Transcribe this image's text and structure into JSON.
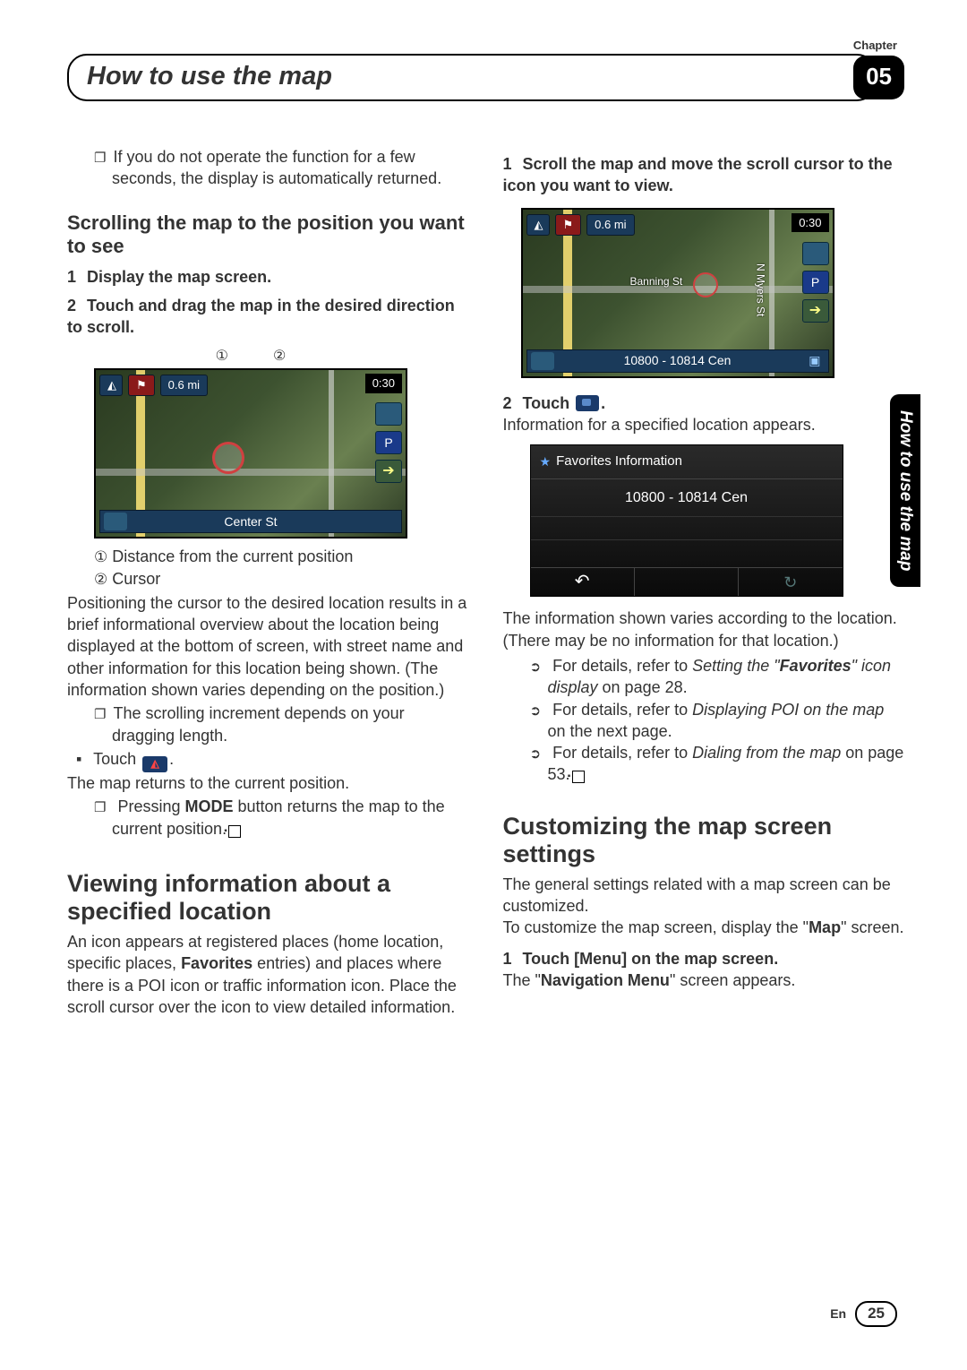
{
  "header": {
    "chapter_label": "Chapter",
    "title": "How to use the map",
    "chapter_num": "05"
  },
  "side_tab": "How to use the map",
  "footer": {
    "lang": "En",
    "page": "25"
  },
  "left": {
    "note1": "If you do not operate the function for a few seconds, the display is automatically returned.",
    "h_scroll": "Scrolling the map to the position you want to see",
    "step1": "Display the map screen.",
    "step2": "Touch and drag the map in the desired direction to scroll.",
    "fig1_label1": "①",
    "fig1_label2": "②",
    "map1": {
      "dist": "0.6 mi",
      "time": "0:30",
      "bottom": "Center St"
    },
    "leg1": "Distance from the current position",
    "leg2": "Cursor",
    "para_cursor": "Positioning the cursor to the desired location results in a brief informational overview about the location being displayed at the bottom of screen, with street name and other information for this location being shown. (The information shown varies depending on the position.)",
    "note_scroll": "The scrolling increment depends on your dragging length.",
    "touch_a_pre": "Touch ",
    "touch_a_post": ".",
    "return_text": "The map returns to the current position.",
    "note_mode_pre": "Pressing ",
    "note_mode_bold": "MODE",
    "note_mode_post": " button returns the map to the current position.",
    "h_viewing": "Viewing information about a specified location",
    "para_viewing_pre": "An icon appears at registered places (home location, specific places, ",
    "para_viewing_bold": "Favorites",
    "para_viewing_post": " entries) and places where there is a POI icon or traffic information icon. Place the scroll cursor over the icon to view detailed information."
  },
  "right": {
    "step1": "Scroll the map and move the scroll cursor to the icon you want to view.",
    "map2": {
      "dist": "0.6 mi",
      "time": "0:30",
      "bottom": "10800 - 10814 Cen",
      "street1": "Banning St",
      "street2": "N Myers St"
    },
    "step2_pre": "Touch ",
    "step2_post": ".",
    "info_appears": "Information for a specified location appears.",
    "fav": {
      "title": "Favorites Information",
      "addr": "10800 - 10814 Cen"
    },
    "para_info": "The information shown varies according to the location. (There may be no information for that location.)",
    "ref1_pre": "For details, refer to ",
    "ref1_it1": "Setting the \"",
    "ref1_bold": "Favorites",
    "ref1_it2": "\" icon display",
    "ref1_post": " on page 28.",
    "ref2_pre": "For details, refer to ",
    "ref2_it": "Displaying POI on the map",
    "ref2_post": " on the next page.",
    "ref3_pre": "For details, refer to ",
    "ref3_it": "Dialing from the map",
    "ref3_post": " on page 53.",
    "h_custom": "Customizing the map screen settings",
    "para_custom1": "The general settings related with a map screen can be customized.",
    "para_custom2_pre": "To customize the map screen, display the \"",
    "para_custom2_bold": "Map",
    "para_custom2_post": "\" screen.",
    "step_custom": "Touch [Menu] on the map screen.",
    "nav_menu_pre": "The \"",
    "nav_menu_bold": "Navigation Menu",
    "nav_menu_post": "\" screen appears."
  }
}
